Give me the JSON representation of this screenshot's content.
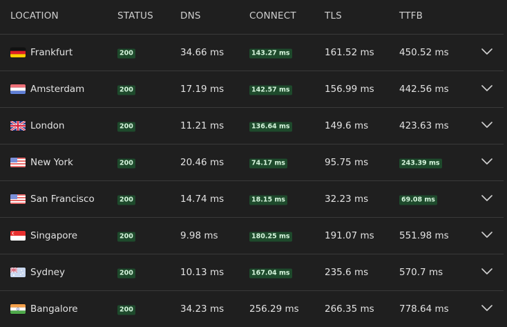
{
  "header": {
    "location": "LOCATION",
    "status": "STATUS",
    "dns": "DNS",
    "connect": "CONNECT",
    "tls": "TLS",
    "ttfb": "TTFB"
  },
  "colors": {
    "background": "#1f1f1f",
    "divider": "#3a3a3a",
    "badge_bg": "#1e4a2c",
    "badge_text": "#d6f5dd"
  },
  "rows": [
    {
      "location": "Frankfurt",
      "flag": "flag-germany-icon",
      "status": "200",
      "dns": "34.66 ms",
      "connect": "143.27 ms",
      "connect_fast": true,
      "tls": "161.52 ms",
      "ttfb": "450.52 ms",
      "ttfb_fast": false
    },
    {
      "location": "Amsterdam",
      "flag": "flag-netherlands-icon",
      "status": "200",
      "dns": "17.19 ms",
      "connect": "142.57 ms",
      "connect_fast": true,
      "tls": "156.99 ms",
      "ttfb": "442.56 ms",
      "ttfb_fast": false
    },
    {
      "location": "London",
      "flag": "flag-uk-icon",
      "status": "200",
      "dns": "11.21 ms",
      "connect": "136.64 ms",
      "connect_fast": true,
      "tls": "149.6 ms",
      "ttfb": "423.63 ms",
      "ttfb_fast": false
    },
    {
      "location": "New York",
      "flag": "flag-usa-icon",
      "status": "200",
      "dns": "20.46 ms",
      "connect": "74.17 ms",
      "connect_fast": true,
      "tls": "95.75 ms",
      "ttfb": "243.39 ms",
      "ttfb_fast": true
    },
    {
      "location": "San Francisco",
      "flag": "flag-usa-icon",
      "status": "200",
      "dns": "14.74 ms",
      "connect": "18.15 ms",
      "connect_fast": true,
      "tls": "32.23 ms",
      "ttfb": "69.08 ms",
      "ttfb_fast": true
    },
    {
      "location": "Singapore",
      "flag": "flag-singapore-icon",
      "status": "200",
      "dns": "9.98 ms",
      "connect": "180.25 ms",
      "connect_fast": true,
      "tls": "191.07 ms",
      "ttfb": "551.98 ms",
      "ttfb_fast": false
    },
    {
      "location": "Sydney",
      "flag": "flag-australia-icon",
      "status": "200",
      "dns": "10.13 ms",
      "connect": "167.04 ms",
      "connect_fast": true,
      "tls": "235.6 ms",
      "ttfb": "570.7 ms",
      "ttfb_fast": false
    },
    {
      "location": "Bangalore",
      "flag": "flag-india-icon",
      "status": "200",
      "dns": "34.23 ms",
      "connect": "256.29 ms",
      "connect_fast": false,
      "tls": "266.35 ms",
      "ttfb": "778.64 ms",
      "ttfb_fast": false
    }
  ]
}
